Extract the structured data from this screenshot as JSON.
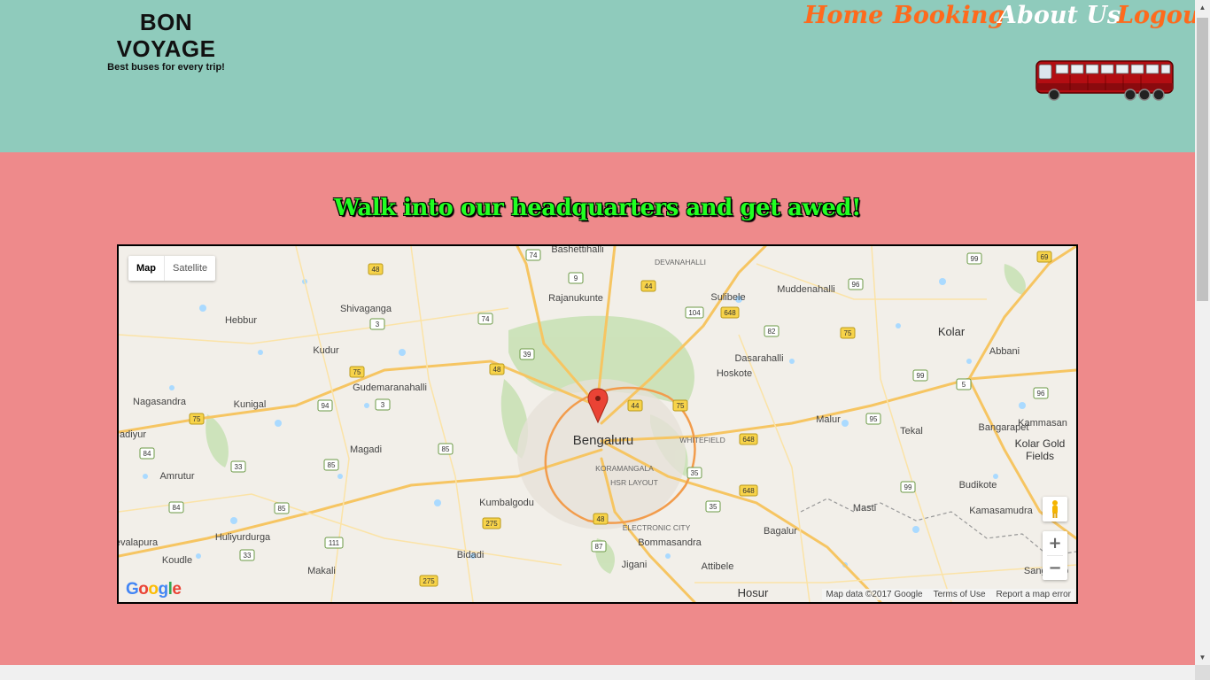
{
  "brand": {
    "title": "BON VOYAGE",
    "tagline": "Best buses for every trip!"
  },
  "nav": {
    "home": "Home",
    "booking": "Booking",
    "about": "About Us",
    "logout": "Logout"
  },
  "colors": {
    "header_bg": "#8fcbbc",
    "main_bg": "#ee8a8b",
    "nav_link": "#ff6a1c",
    "nav_active": "#ffffff",
    "headline": "#22ff22"
  },
  "main": {
    "headline": "Walk into our headquarters and get awed!"
  },
  "map": {
    "type_map": "Map",
    "type_satellite": "Satellite",
    "zoom_in": "+",
    "zoom_out": "−",
    "attribution": "Map data ©2017 Google",
    "terms": "Terms of Use",
    "report": "Report a map error",
    "logo": "Google",
    "marker_city": "Bengaluru",
    "places": [
      {
        "name": "Bashettihalli"
      },
      {
        "name": "DEVANAHALLI"
      },
      {
        "name": "Rajanukunte"
      },
      {
        "name": "Sulibele"
      },
      {
        "name": "Muddenahalli"
      },
      {
        "name": "Hebbur"
      },
      {
        "name": "Shivaganga"
      },
      {
        "name": "Kolar"
      },
      {
        "name": "Abbani"
      },
      {
        "name": "Kudur"
      },
      {
        "name": "Dasarahalli"
      },
      {
        "name": "Hoskote"
      },
      {
        "name": "Gudemaranahalli"
      },
      {
        "name": "Nagasandra"
      },
      {
        "name": "Kunigal"
      },
      {
        "name": "Malur"
      },
      {
        "name": "Kammasan"
      },
      {
        "name": "Bangarapet"
      },
      {
        "name": "Tekal"
      },
      {
        "name": "Kolar Gold"
      },
      {
        "name": "Fields"
      },
      {
        "name": "adiyur"
      },
      {
        "name": "Magadi"
      },
      {
        "name": "WHITEFIELD"
      },
      {
        "name": "Bengaluru"
      },
      {
        "name": "KORAMANGALA"
      },
      {
        "name": "HSR LAYOUT"
      },
      {
        "name": "Amrutur"
      },
      {
        "name": "Kumbalgodu"
      },
      {
        "name": "Budikote"
      },
      {
        "name": "Masti"
      },
      {
        "name": "Kamasamudra"
      },
      {
        "name": "ELECTRONIC CITY"
      },
      {
        "name": "evalapura"
      },
      {
        "name": "Huliyurdurga"
      },
      {
        "name": "Bommasandra"
      },
      {
        "name": "Bagalur"
      },
      {
        "name": "Koudle"
      },
      {
        "name": "Bidadi"
      },
      {
        "name": "Jigani"
      },
      {
        "name": "Attibele"
      },
      {
        "name": "Sanganap"
      },
      {
        "name": "Makali"
      },
      {
        "name": "Hosur"
      }
    ],
    "shields": [
      "74",
      "9",
      "44",
      "48",
      "104",
      "648",
      "96",
      "99",
      "69",
      "3",
      "74",
      "82",
      "75",
      "39",
      "48",
      "75",
      "99",
      "5",
      "96",
      "94",
      "3",
      "75",
      "44",
      "75",
      "648",
      "95",
      "84",
      "85",
      "33",
      "85",
      "35",
      "648",
      "99",
      "84",
      "85",
      "48",
      "275",
      "35",
      "111",
      "33",
      "87",
      "275"
    ]
  }
}
